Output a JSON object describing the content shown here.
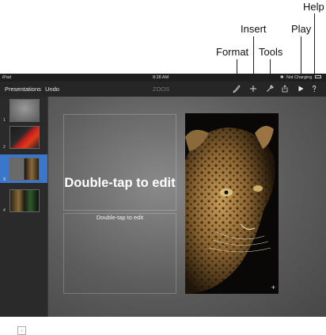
{
  "callouts": {
    "format": "Format",
    "insert": "Insert",
    "tools": "Tools",
    "play": "Play",
    "help": "Help"
  },
  "status_bar": {
    "device": "iPad",
    "time": "8:28 AM",
    "battery": "Not Charging"
  },
  "toolbar": {
    "presentations_label": "Presentations",
    "undo_label": "Undo",
    "document_title": "ZOOS"
  },
  "slides": [
    {
      "number": "1"
    },
    {
      "number": "2"
    },
    {
      "number": "3",
      "selected": true
    },
    {
      "number": "4"
    }
  ],
  "slide": {
    "title_placeholder": "Double-tap to edit",
    "body_placeholder": "Double-tap to edit"
  },
  "colors": {
    "selection": "#3a76c9",
    "toolbar": "#262626"
  },
  "icons": {
    "format": "paintbrush-icon",
    "insert": "plus-icon",
    "tools": "wrench-icon",
    "share": "share-icon",
    "play": "play-icon",
    "help": "help-icon",
    "add_slide": "plus-icon",
    "photo_edit": "plus-icon"
  }
}
